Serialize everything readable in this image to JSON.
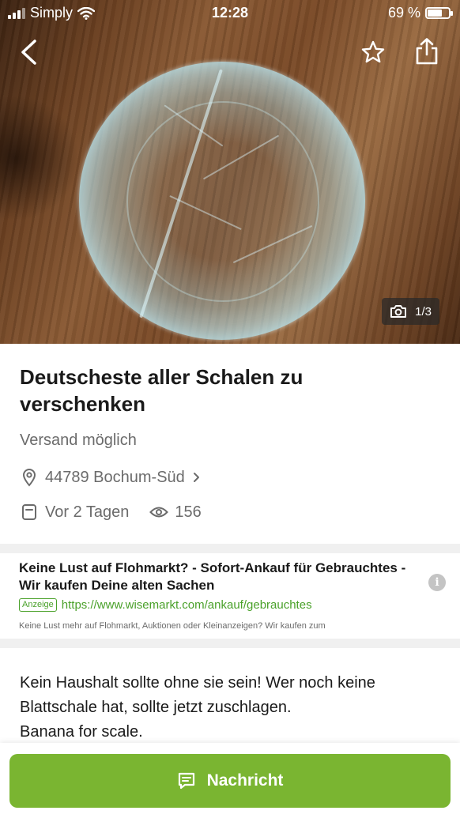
{
  "status_bar": {
    "carrier": "Simply",
    "time": "12:28",
    "battery_text": "69 %",
    "battery_level": 0.69
  },
  "hero": {
    "photo_counter": "1/3",
    "icons": [
      "back-icon",
      "star-icon",
      "share-icon",
      "camera-icon"
    ]
  },
  "listing": {
    "title": "Deutscheste aller Schalen zu verschenken",
    "shipping": "Versand möglich",
    "location": "44789 Bochum-Süd",
    "posted": "Vor 2 Tagen",
    "views": "156",
    "description_lines": [
      "Kein Haushalt sollte ohne sie sein! Wer noch keine",
      "Blattschale hat, sollte jetzt zuschlagen.",
      "Banana for scale."
    ]
  },
  "ad": {
    "title": "Keine Lust auf Flohmarkt? - Sofort-Ankauf für Gebrauchtes - Wir kaufen Deine alten Sachen",
    "badge": "Anzeige",
    "url": "https://www.wisemarkt.com/ankauf/gebrauchtes",
    "description": "Keine Lust mehr auf Flohmarkt, Auktionen oder Kleinanzeigen? Wir kaufen zum",
    "info_symbol": "i"
  },
  "actions": {
    "message_label": "Nachricht"
  },
  "colors": {
    "accent": "#7ab531",
    "ad_green": "#4aa12a",
    "muted_text": "#6b6b6b"
  }
}
